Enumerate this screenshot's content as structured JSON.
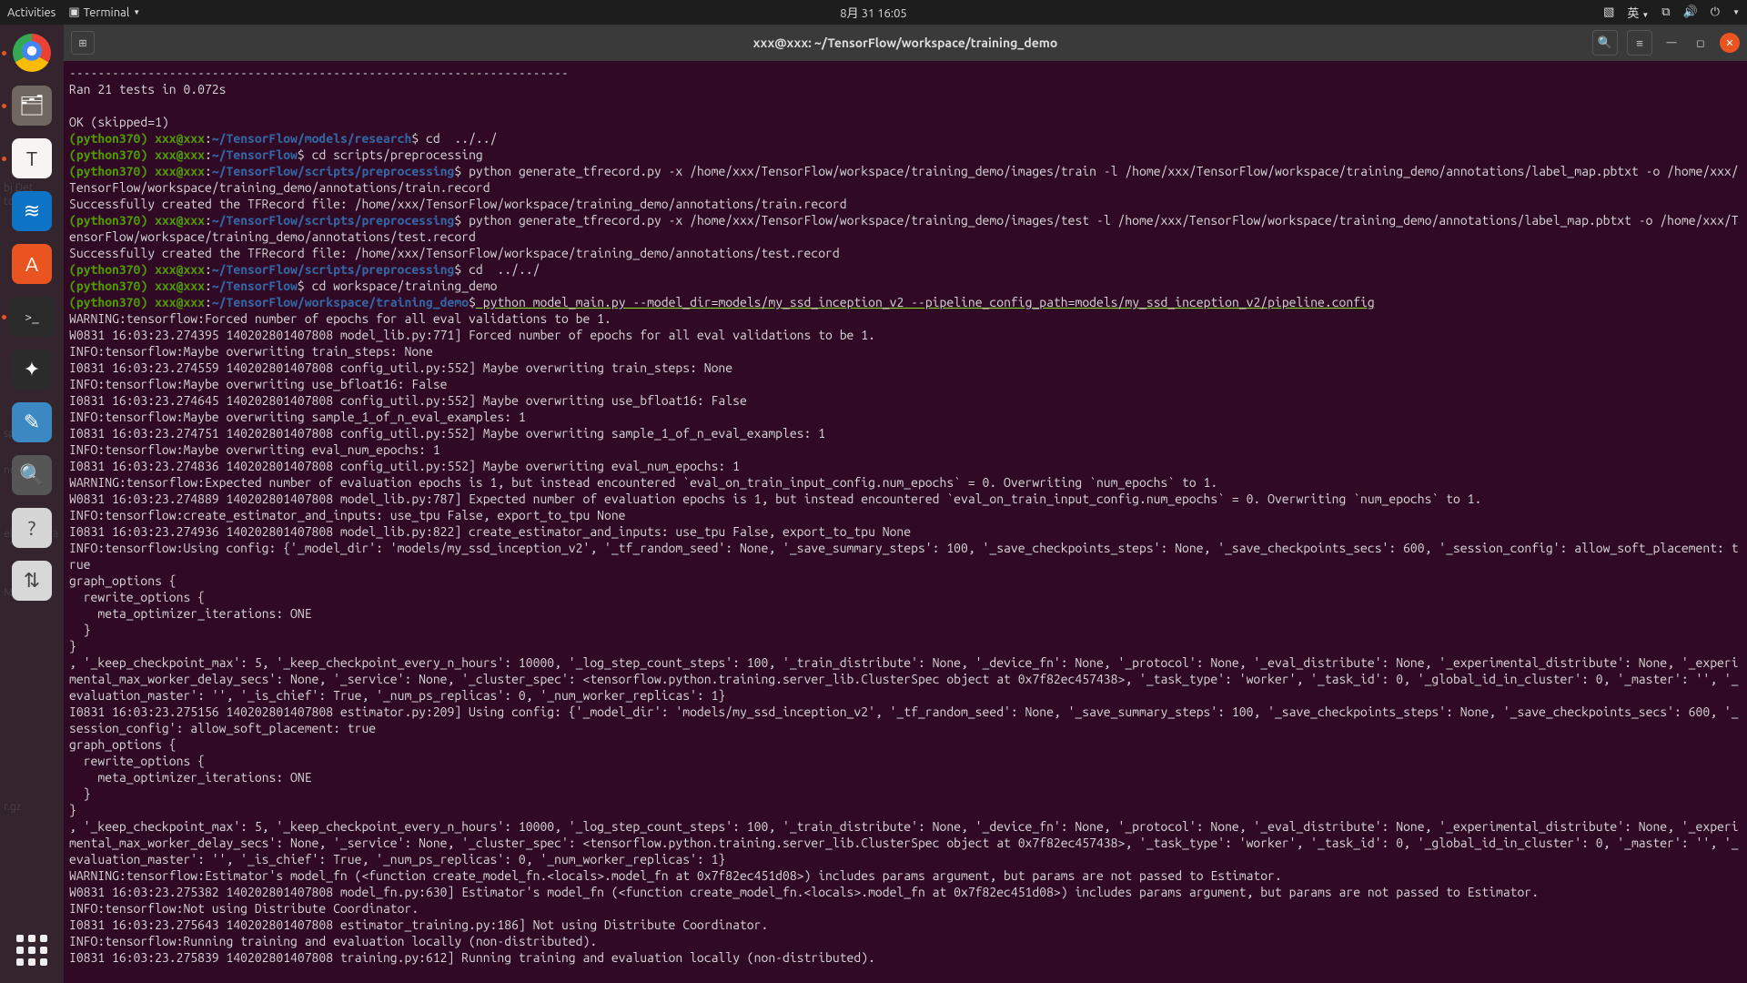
{
  "topbar": {
    "activities": "Activities",
    "term_label": "Terminal",
    "clock": "8月 31 16:05",
    "lang": "英"
  },
  "window": {
    "title": "xxx@xxx: ~/TensorFlow/workspace/training_demo"
  },
  "shell": {
    "env": "(python370) ",
    "user": "xxx@xxx",
    "sep": ":",
    "dollar": "$",
    "p_research": "~/TensorFlow/models/research",
    "p_tf": "~/TensorFlow",
    "p_pre": "~/TensorFlow/scripts/preprocessing",
    "p_demo": "~/TensorFlow/workspace/training_demo",
    "cmd1": " cd  ../../",
    "cmd2": " cd scripts/preprocessing",
    "cmd3": " python generate_tfrecord.py -x /home/xxx/TensorFlow/workspace/training_demo/images/train -l /home/xxx/TensorFlow/workspace/training_demo/annotations/label_map.pbtxt -o /home/xxx/TensorFlow/workspace/training_demo/annotations/train.record",
    "cmd4": " python generate_tfrecord.py -x /home/xxx/TensorFlow/workspace/training_demo/images/test -l /home/xxx/TensorFlow/workspace/training_demo/annotations/label_map.pbtxt -o /home/xxx/TensorFlow/workspace/training_demo/annotations/test.record",
    "cmd5": " cd  ../../",
    "cmd6": " cd workspace/training_demo",
    "cmd7": " python model_main.py --model_dir=models/my_ssd_inception_v2 --pipeline_config_path=models/my_ssd_inception_v2/pipeline.config"
  },
  "lines": {
    "dashes": "----------------------------------------------------------------------",
    "ran": "Ran 21 tests in 0.072s",
    "ok": "OK (skipped=1)",
    "created_train": "Successfully created the TFRecord file: /home/xxx/TensorFlow/workspace/training_demo/annotations/train.record",
    "created_test": "Successfully created the TFRecord file: /home/xxx/TensorFlow/workspace/training_demo/annotations/test.record"
  },
  "log": [
    "WARNING:tensorflow:Forced number of epochs for all eval validations to be 1.",
    "W0831 16:03:23.274395 140202801407808 model_lib.py:771] Forced number of epochs for all eval validations to be 1.",
    "INFO:tensorflow:Maybe overwriting train_steps: None",
    "I0831 16:03:23.274559 140202801407808 config_util.py:552] Maybe overwriting train_steps: None",
    "INFO:tensorflow:Maybe overwriting use_bfloat16: False",
    "I0831 16:03:23.274645 140202801407808 config_util.py:552] Maybe overwriting use_bfloat16: False",
    "INFO:tensorflow:Maybe overwriting sample_1_of_n_eval_examples: 1",
    "I0831 16:03:23.274751 140202801407808 config_util.py:552] Maybe overwriting sample_1_of_n_eval_examples: 1",
    "INFO:tensorflow:Maybe overwriting eval_num_epochs: 1",
    "I0831 16:03:23.274836 140202801407808 config_util.py:552] Maybe overwriting eval_num_epochs: 1",
    "WARNING:tensorflow:Expected number of evaluation epochs is 1, but instead encountered `eval_on_train_input_config.num_epochs` = 0. Overwriting `num_epochs` to 1.",
    "W0831 16:03:23.274889 140202801407808 model_lib.py:787] Expected number of evaluation epochs is 1, but instead encountered `eval_on_train_input_config.num_epochs` = 0. Overwriting `num_epochs` to 1.",
    "INFO:tensorflow:create_estimator_and_inputs: use_tpu False, export_to_tpu None",
    "I0831 16:03:23.274936 140202801407808 model_lib.py:822] create_estimator_and_inputs: use_tpu False, export_to_tpu None",
    "INFO:tensorflow:Using config: {'_model_dir': 'models/my_ssd_inception_v2', '_tf_random_seed': None, '_save_summary_steps': 100, '_save_checkpoints_steps': None, '_save_checkpoints_secs': 600, '_session_config': allow_soft_placement: true",
    "graph_options {",
    "  rewrite_options {",
    "    meta_optimizer_iterations: ONE",
    "  }",
    "}",
    ", '_keep_checkpoint_max': 5, '_keep_checkpoint_every_n_hours': 10000, '_log_step_count_steps': 100, '_train_distribute': None, '_device_fn': None, '_protocol': None, '_eval_distribute': None, '_experimental_distribute': None, '_experimental_max_worker_delay_secs': None, '_service': None, '_cluster_spec': <tensorflow.python.training.server_lib.ClusterSpec object at 0x7f82ec457438>, '_task_type': 'worker', '_task_id': 0, '_global_id_in_cluster': 0, '_master': '', '_evaluation_master': '', '_is_chief': True, '_num_ps_replicas': 0, '_num_worker_replicas': 1}",
    "I0831 16:03:23.275156 140202801407808 estimator.py:209] Using config: {'_model_dir': 'models/my_ssd_inception_v2', '_tf_random_seed': None, '_save_summary_steps': 100, '_save_checkpoints_steps': None, '_save_checkpoints_secs': 600, '_session_config': allow_soft_placement: true",
    "graph_options {",
    "  rewrite_options {",
    "    meta_optimizer_iterations: ONE",
    "  }",
    "}",
    ", '_keep_checkpoint_max': 5, '_keep_checkpoint_every_n_hours': 10000, '_log_step_count_steps': 100, '_train_distribute': None, '_device_fn': None, '_protocol': None, '_eval_distribute': None, '_experimental_distribute': None, '_experimental_max_worker_delay_secs': None, '_service': None, '_cluster_spec': <tensorflow.python.training.server_lib.ClusterSpec object at 0x7f82ec457438>, '_task_type': 'worker', '_task_id': 0, '_global_id_in_cluster': 0, '_master': '', '_evaluation_master': '', '_is_chief': True, '_num_ps_replicas': 0, '_num_worker_replicas': 1}",
    "WARNING:tensorflow:Estimator's model_fn (<function create_model_fn.<locals>.model_fn at 0x7f82ec451d08>) includes params argument, but params are not passed to Estimator.",
    "W0831 16:03:23.275382 140202801407808 model_fn.py:630] Estimator's model_fn (<function create_model_fn.<locals>.model_fn at 0x7f82ec451d08>) includes params argument, but params are not passed to Estimator.",
    "INFO:tensorflow:Not using Distribute Coordinator.",
    "I0831 16:03:23.275643 140202801407808 estimator_training.py:186] Not using Distribute Coordinator.",
    "INFO:tensorflow:Running training and evaluation locally (non-distributed).",
    "I0831 16:03:23.275839 140202801407808 training.py:612] Running training and evaluation locally (non-distributed)."
  ],
  "desk": {
    "l1": "bj Det",
    "l2": "torial",
    "l3": "space",
    "l4": "ng Job",
    "l5": "el (Optiona",
    "l6": "Model",
    "l7": "r.gz"
  }
}
